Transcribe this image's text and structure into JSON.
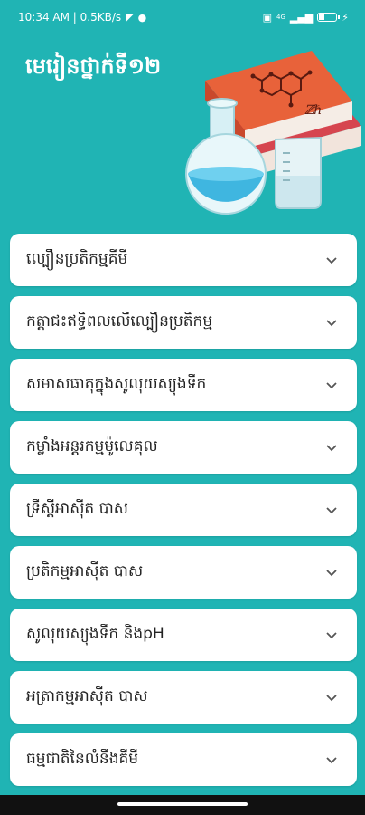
{
  "status_bar": {
    "time_speed": "10:34 AM | 0.5KB/s",
    "network": "4G",
    "icons": [
      "telegram-icon",
      "messenger-icon",
      "nfc-icon",
      "signal-icon",
      "battery-icon",
      "charging-icon"
    ]
  },
  "header": {
    "title": "មេរៀនថ្នាក់ទី១២",
    "illustration": "chemistry-books-and-flasks"
  },
  "items": [
    {
      "label": "ល្បឿនប្រតិកម្មគីមី"
    },
    {
      "label": "កត្តាជះឥទ្ធិពលលើល្បឿនប្រតិកម្ម"
    },
    {
      "label": "សមាសធាតុក្នុងសូលុយស្យុងទឹក"
    },
    {
      "label": "កម្លាំងអន្តរកម្មម៉ូលេគុល"
    },
    {
      "label": "ទ្រឹស្តីអាស៊ីត បាស"
    },
    {
      "label": "ប្រតិកម្មអាស៊ីត បាស"
    },
    {
      "label": "សូលុយស្យុងទឹក និងpH"
    },
    {
      "label": "អត្រាកម្មអាស៊ីត បាស"
    },
    {
      "label": "ធម្មជាតិនៃលំនឹងគីមី"
    }
  ],
  "colors": {
    "background": "#20b4b4",
    "card": "#ffffff",
    "book_top": "#e8623a",
    "book_bottom": "#d6454f"
  }
}
